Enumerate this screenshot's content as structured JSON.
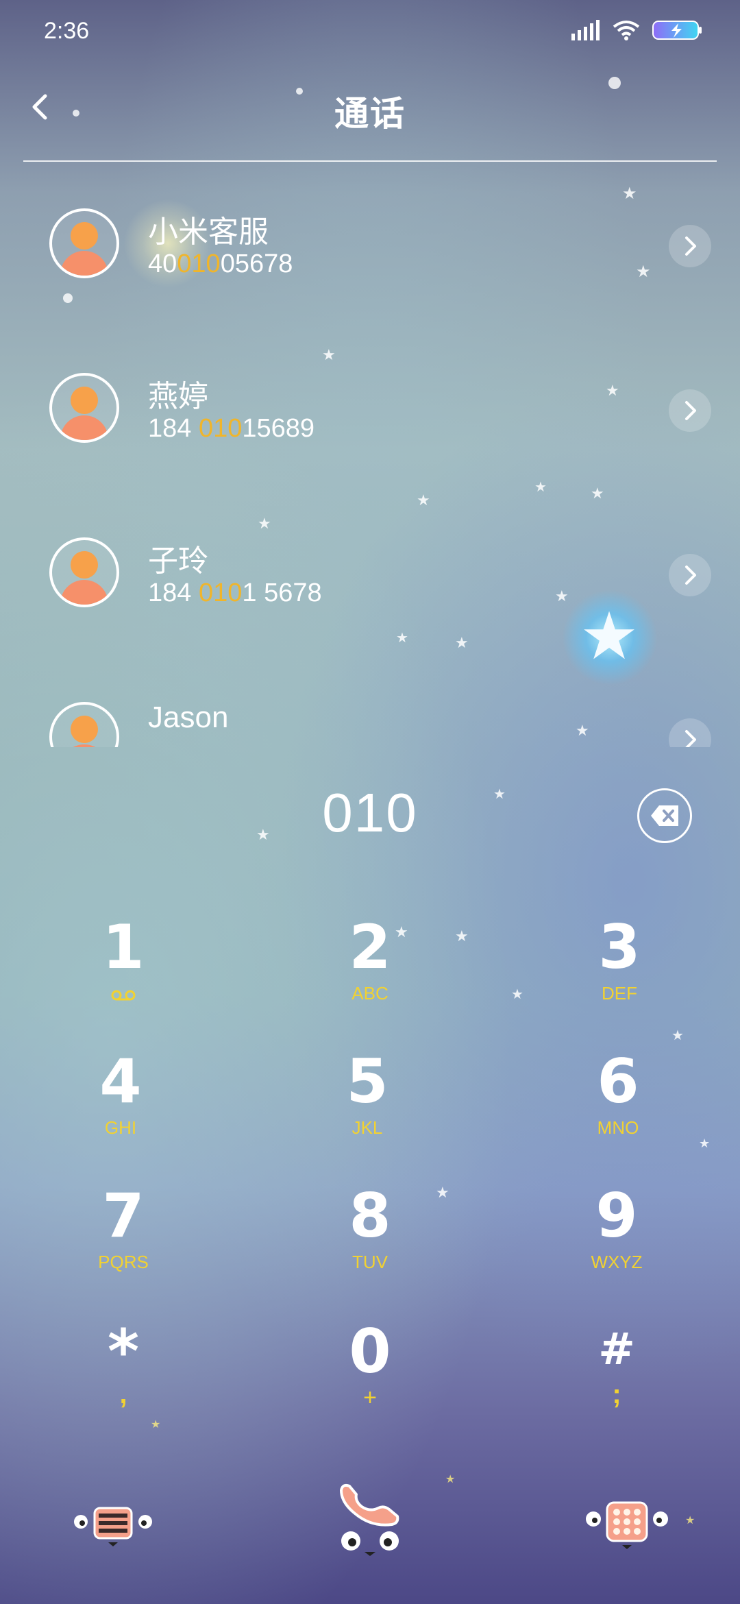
{
  "status_bar": {
    "time": "2:36"
  },
  "header": {
    "title": "通话"
  },
  "contacts": [
    {
      "name": "小米客服",
      "number_pre": "40",
      "number_match": "010",
      "number_post": "05678"
    },
    {
      "name": "燕婷",
      "number_pre": "184 ",
      "number_match": "010",
      "number_post": "15689"
    },
    {
      "name": "子玲",
      "number_pre": "184 ",
      "number_match": "010",
      "number_post": "1 5678"
    },
    {
      "name": "Jason",
      "number_pre": "",
      "number_match": "",
      "number_post": ""
    }
  ],
  "dialer": {
    "input": "010",
    "keys": [
      {
        "digit": "1",
        "letters": ""
      },
      {
        "digit": "2",
        "letters": "ABC"
      },
      {
        "digit": "3",
        "letters": "DEF"
      },
      {
        "digit": "4",
        "letters": "GHI"
      },
      {
        "digit": "5",
        "letters": "JKL"
      },
      {
        "digit": "6",
        "letters": "MNO"
      },
      {
        "digit": "7",
        "letters": "PQRS"
      },
      {
        "digit": "8",
        "letters": "TUV"
      },
      {
        "digit": "9",
        "letters": "WXYZ"
      },
      {
        "digit": "*",
        "letters": ","
      },
      {
        "digit": "0",
        "letters": "+"
      },
      {
        "digit": "#",
        "letters": ";"
      }
    ]
  },
  "colors": {
    "highlight": "#f0b52b",
    "key_letters": "#f2d231",
    "avatar_head": "#f7a14a",
    "avatar_body": "#f6906a",
    "call_handset": "#f5a08a"
  },
  "icons": {
    "status": [
      "signal-icon",
      "wifi-icon",
      "battery-charging-icon"
    ],
    "header": "back-icon",
    "row": "chevron-right-icon",
    "dialer": "backspace-icon",
    "voicemail": "voicemail-icon",
    "nav": [
      "menu-icon",
      "call-icon",
      "dialpad-icon"
    ]
  }
}
